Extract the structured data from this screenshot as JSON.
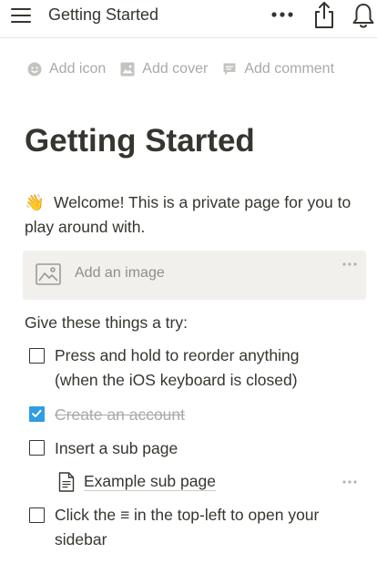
{
  "topbar": {
    "title": "Getting Started",
    "icons": [
      "hamburger-menu-icon",
      "more-horizontal-icon",
      "share-icon",
      "bell-icon"
    ]
  },
  "page_actions": [
    {
      "label": "Add icon",
      "icon": "smiley-icon"
    },
    {
      "label": "Add cover",
      "icon": "image-icon"
    },
    {
      "label": "Add comment",
      "icon": "comment-icon"
    }
  ],
  "page": {
    "title": "Getting Started",
    "welcome_emoji": "👋",
    "welcome_text": "Welcome! This is a private page for you to play around with.",
    "image_block_label": "Add an image",
    "try_heading": "Give these things a try:",
    "todos": [
      {
        "label": "Press and hold to reorder anything",
        "label_line2": "(when the iOS keyboard is closed)",
        "checked": false
      },
      {
        "label": "Create an account",
        "checked": true
      },
      {
        "label": "Insert a sub page",
        "checked": false
      },
      {
        "label": "Click the ≡ in the top-left to open your",
        "label_line2": "sidebar",
        "checked": false
      }
    ],
    "subpage_label": "Example sub page"
  },
  "colors": {
    "text": "#37352f",
    "muted": "#a9a9a6",
    "checkbox_checked": "#2f9de2",
    "image_block_bg": "#f1f0ed"
  }
}
